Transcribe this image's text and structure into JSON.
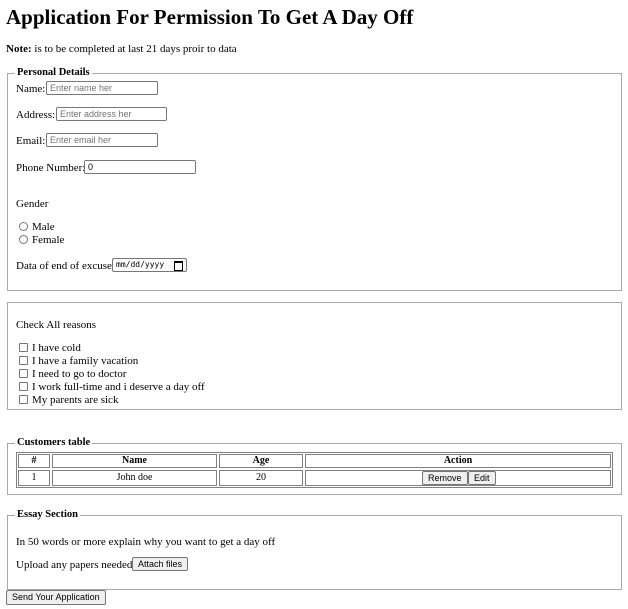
{
  "page": {
    "title": "Application For Permission To Get A Day Off",
    "note_label": "Note:",
    "note_text": "is to be completed at last 21 days proir to data"
  },
  "personal": {
    "legend": "Personal Details",
    "name_label": "Name:",
    "name_placeholder": "Enter name her",
    "address_label": "Address:",
    "address_placeholder": "Enter address her",
    "email_label": "Email:",
    "email_placeholder": "Enter email her",
    "phone_label": "Phone Number:",
    "phone_value": "0",
    "gender_label": "Gender",
    "gender_options": [
      "Male",
      "Female"
    ],
    "date_label": "Data of end of excuse:",
    "date_placeholder": "mm/dd/yyyy"
  },
  "reasons": {
    "heading": "Check All reasons",
    "items": [
      "I have cold",
      "I have a family vacation",
      "I need to go to doctor",
      "I work full-time and i deserve a day off",
      "My parents are sick"
    ]
  },
  "customers": {
    "legend": "Customers table",
    "headers": [
      "#",
      "Name",
      "Age",
      "Action"
    ],
    "rows": [
      {
        "id": "1",
        "name": "John doe",
        "age": "20"
      }
    ],
    "remove_label": "Remove",
    "edit_label": "Edit"
  },
  "essay": {
    "legend": "Essay Section",
    "prompt": "In 50 words or more explain why you want to get a day off",
    "upload_label": "Upload any papers needed:",
    "attach_label": "Attach files"
  },
  "submit_label": "Send Your Application"
}
